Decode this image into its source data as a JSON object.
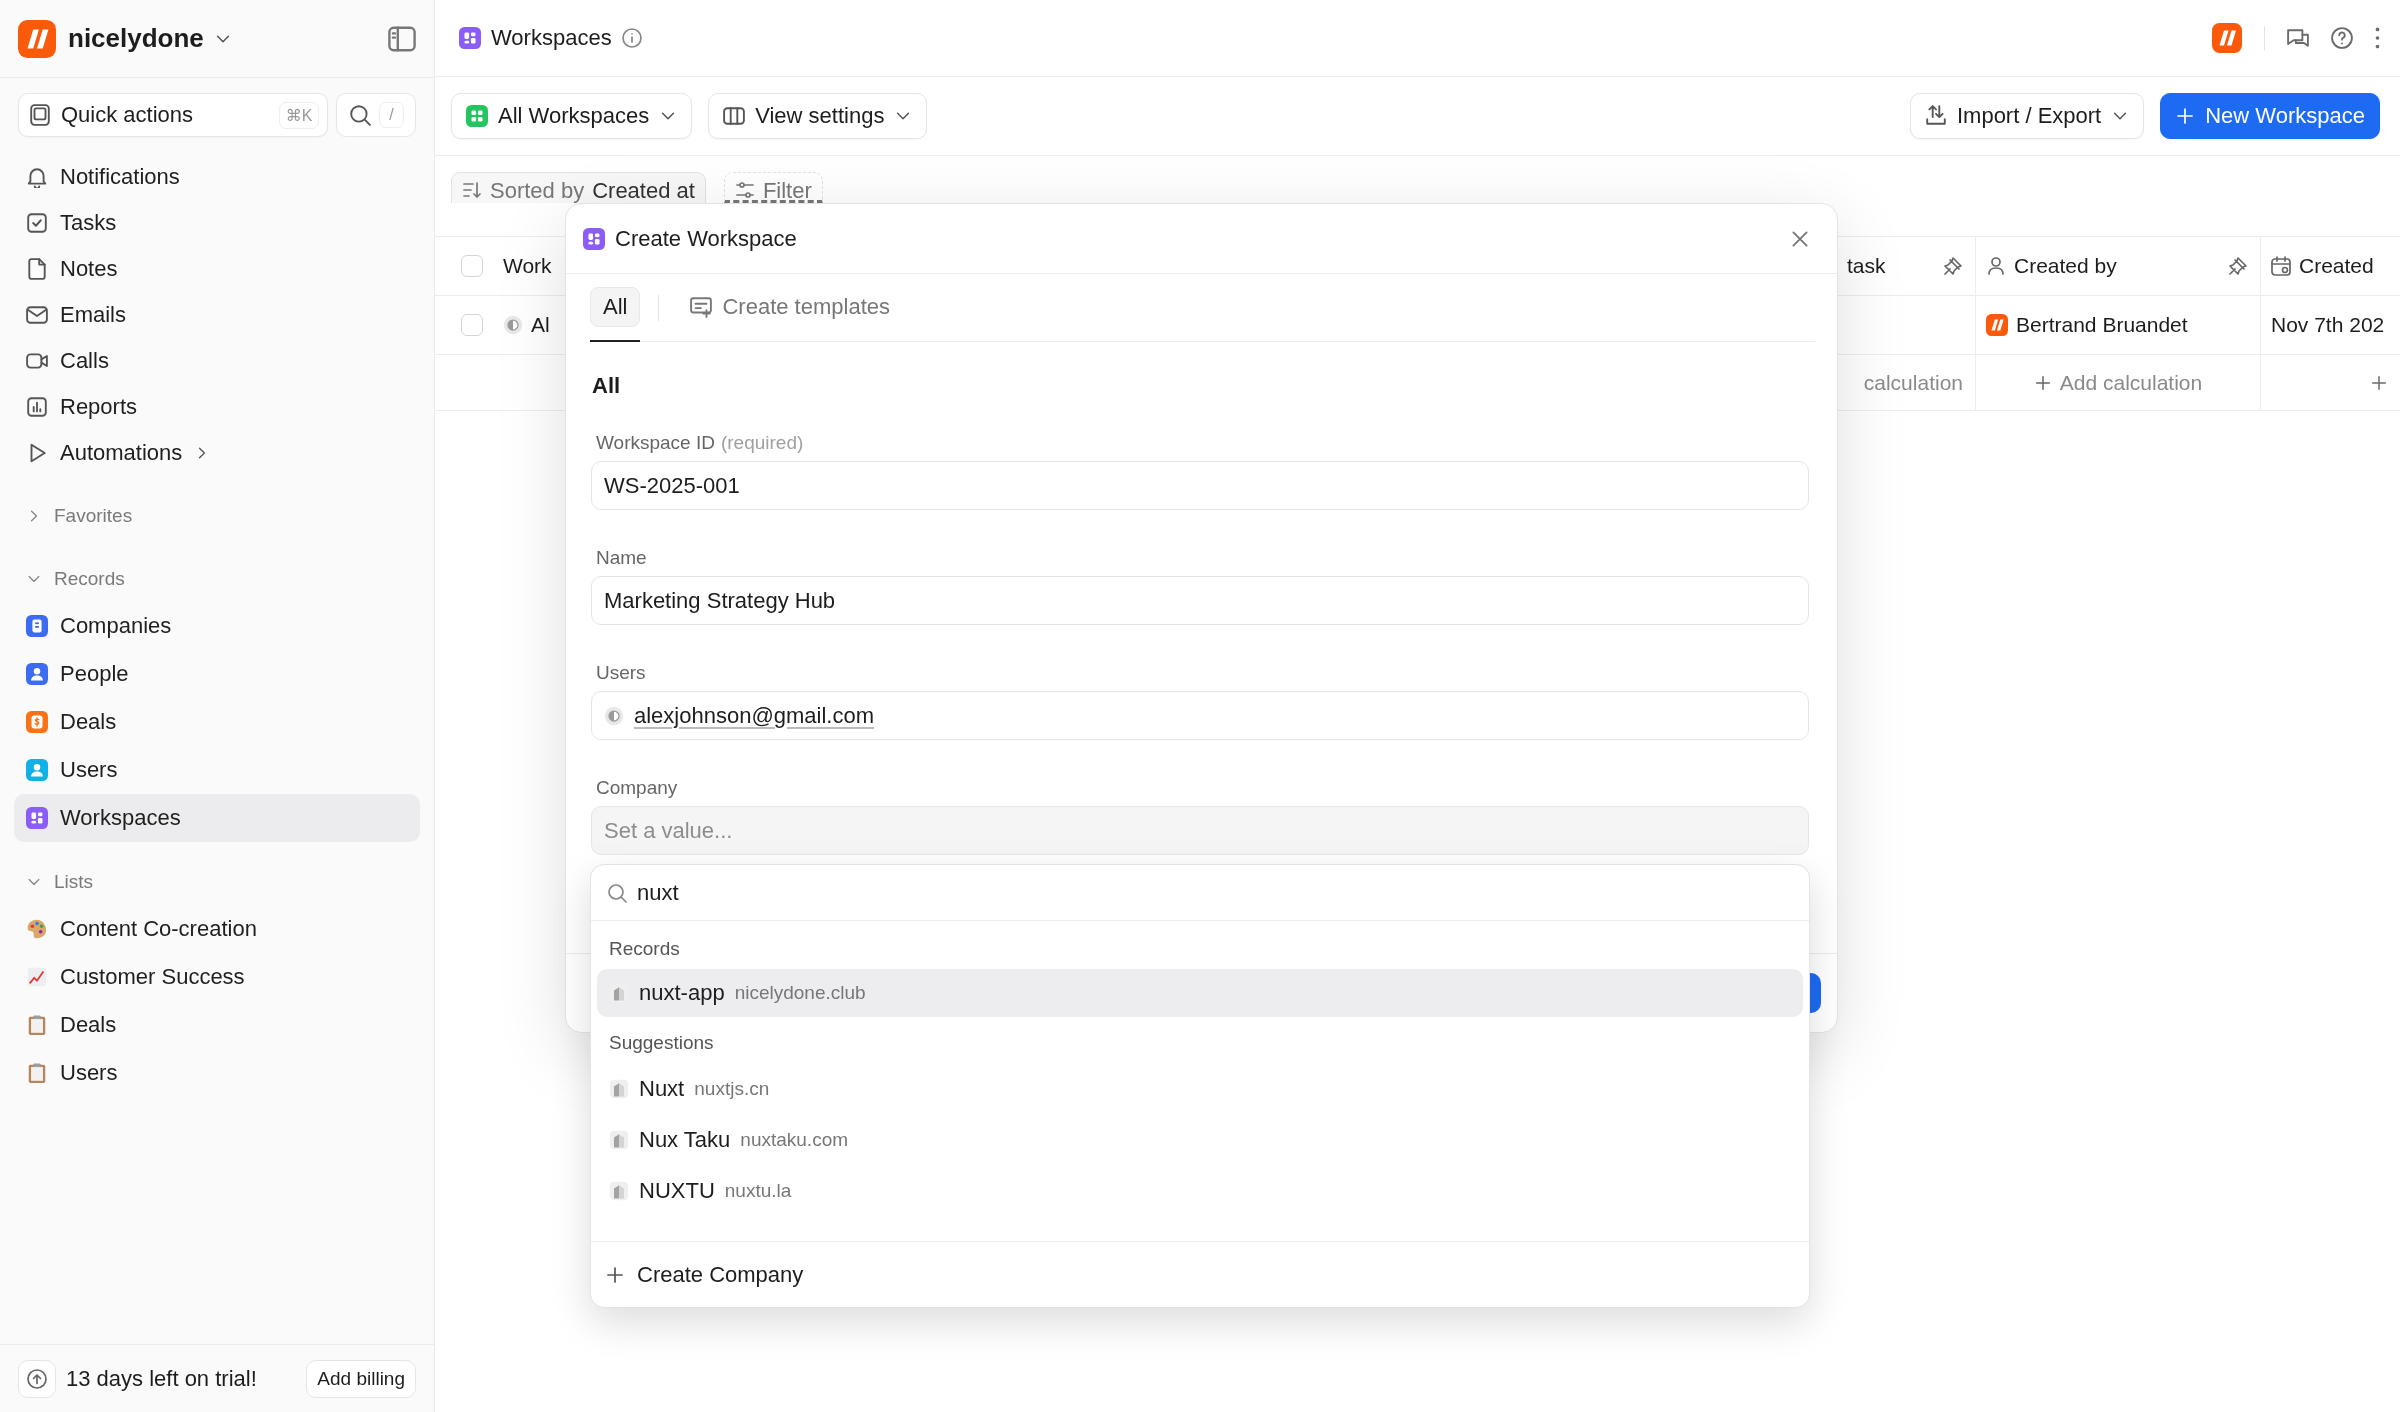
{
  "workspace": {
    "name": "nicelydone"
  },
  "quick_actions": {
    "label": "Quick actions",
    "shortcut": "⌘K"
  },
  "search": {
    "shortcut": "/"
  },
  "nav": [
    {
      "label": "Notifications",
      "selected": false,
      "submenu": false
    },
    {
      "label": "Tasks",
      "selected": false,
      "submenu": false
    },
    {
      "label": "Notes",
      "selected": false,
      "submenu": false
    },
    {
      "label": "Emails",
      "selected": false,
      "submenu": false
    },
    {
      "label": "Calls",
      "selected": false,
      "submenu": false
    },
    {
      "label": "Reports",
      "selected": false,
      "submenu": false
    },
    {
      "label": "Automations",
      "selected": false,
      "submenu": true
    }
  ],
  "sections": [
    {
      "title": "Favorites",
      "expanded": false
    },
    {
      "title": "Records",
      "expanded": true,
      "items": [
        {
          "label": "Companies",
          "selected": false
        },
        {
          "label": "People",
          "selected": false
        },
        {
          "label": "Deals",
          "selected": false
        },
        {
          "label": "Users",
          "selected": false
        },
        {
          "label": "Workspaces",
          "selected": true
        }
      ]
    },
    {
      "title": "Lists",
      "expanded": true,
      "items": [
        {
          "label": "Content Co-creation",
          "selected": false
        },
        {
          "label": "Customer Success",
          "selected": false
        },
        {
          "label": "Deals",
          "selected": false
        },
        {
          "label": "Users",
          "selected": false
        }
      ]
    }
  ],
  "trial": {
    "text": "13 days left on trial!",
    "button": "Add billing"
  },
  "page": {
    "title": "Workspaces"
  },
  "toolbar": {
    "view": "All Workspaces",
    "view_settings": "View settings",
    "import_export": "Import / Export",
    "new_button": "New Workspace"
  },
  "sort": {
    "label": "Sorted by",
    "field": "Created at"
  },
  "filter": {
    "label": "Filter"
  },
  "table": {
    "header_checked": false,
    "columns": [
      {
        "label": "Work"
      },
      {
        "label": "task"
      },
      {
        "label": "Created by"
      },
      {
        "label": "Created"
      }
    ],
    "rows": [
      {
        "checked": false,
        "first": "Al",
        "created_by": "Bertrand Bruandet",
        "created": "Nov 7th 202"
      }
    ],
    "calculation_row": {
      "task": "calculation",
      "created_by": "Add calculation"
    }
  },
  "modal": {
    "title": "Create Workspace",
    "tabs": [
      {
        "label": "All",
        "selected": true
      },
      {
        "label": "Create templates",
        "selected": false
      }
    ],
    "section": "All",
    "fields": [
      {
        "kind": "text",
        "label": "Workspace ID",
        "note": "(required)",
        "value": "WS-2025-001"
      },
      {
        "kind": "text",
        "label": "Name",
        "value": "Marketing Strategy Hub"
      },
      {
        "kind": "user",
        "label": "Users",
        "value": "alexjohnson@gmail.com"
      },
      {
        "kind": "select",
        "label": "Company",
        "placeholder": "Set a value..."
      }
    ]
  },
  "dropdown": {
    "query": "nuxt",
    "groups": [
      {
        "title": "Records",
        "items": [
          {
            "name": "nuxt-app",
            "domain": "nicelydone.club",
            "selected": true
          }
        ]
      },
      {
        "title": "Suggestions",
        "items": [
          {
            "name": "Nuxt",
            "domain": "nuxtjs.cn",
            "selected": false
          },
          {
            "name": "Nux Taku",
            "domain": "nuxtaku.com",
            "selected": false
          },
          {
            "name": "NUXTU",
            "domain": "nuxtu.la",
            "selected": false
          }
        ]
      }
    ],
    "create": "Create Company"
  }
}
